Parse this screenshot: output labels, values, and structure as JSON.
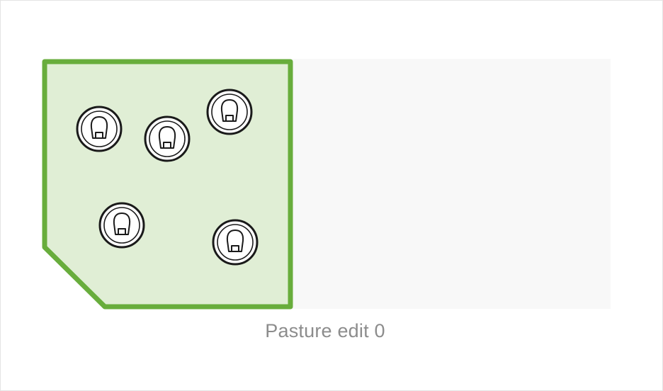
{
  "pasture": {
    "caption": "Pasture edit 0",
    "fill_color": "#e0eed5",
    "stroke_color": "#68ad3c"
  },
  "animals": [
    {
      "id": "cow-1",
      "icon": "cow-face-icon"
    },
    {
      "id": "cow-2",
      "icon": "cow-face-icon"
    },
    {
      "id": "cow-3",
      "icon": "cow-face-icon"
    },
    {
      "id": "cow-4",
      "icon": "cow-face-icon"
    },
    {
      "id": "cow-5",
      "icon": "cow-face-icon"
    }
  ]
}
